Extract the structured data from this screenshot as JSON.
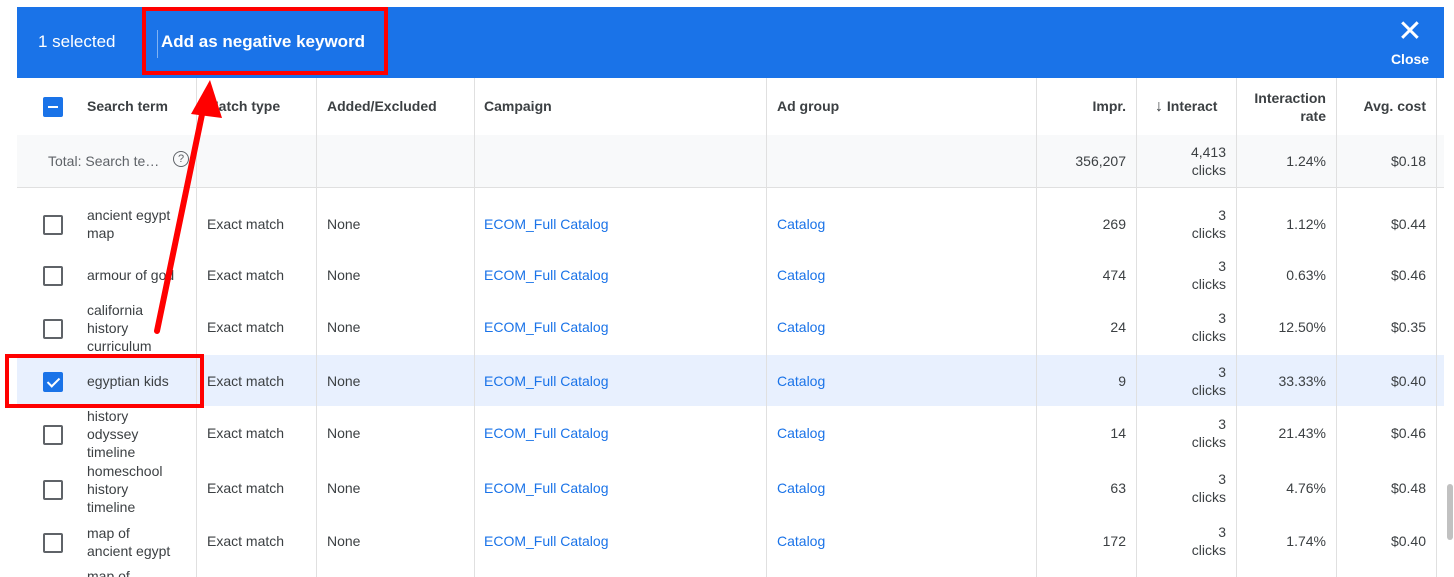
{
  "toolbar": {
    "selected_count": "1 selected",
    "add_negative_label": "Add as negative keyword",
    "close_label": "Close",
    "close_glyph": "✕"
  },
  "header": {
    "search_term": "Search term",
    "match_type": "Match type",
    "added_excluded": "Added/Excluded",
    "campaign": "Campaign",
    "ad_group": "Ad group",
    "impr": "Impr.",
    "interactions": "Interact",
    "interaction_rate_l1": "Interaction",
    "interaction_rate_l2": "rate",
    "avg_cost": "Avg. cost",
    "sort_glyph": "↓"
  },
  "total": {
    "label": "Total: Search te…",
    "help_glyph": "?",
    "impr": "356,207",
    "interactions_l1": "4,413",
    "interactions_l2": "clicks",
    "rate": "1.24%",
    "avg_cost": "$0.18"
  },
  "rows": [
    {
      "term_l1": "ancient egypt",
      "term_l2": "map",
      "term_l3": "",
      "match": "Exact match",
      "added": "None",
      "campaign": "ECOM_Full Catalog",
      "ad_group": "Catalog",
      "impr": "269",
      "int_l1": "3",
      "int_l2": "clicks",
      "rate": "1.12%",
      "cost": "$0.44"
    },
    {
      "term_l1": "armour of god",
      "term_l2": "",
      "term_l3": "",
      "match": "Exact match",
      "added": "None",
      "campaign": "ECOM_Full Catalog",
      "ad_group": "Catalog",
      "impr": "474",
      "int_l1": "3",
      "int_l2": "clicks",
      "rate": "0.63%",
      "cost": "$0.46"
    },
    {
      "term_l1": "california",
      "term_l2": "history",
      "term_l3": "curriculum",
      "match": "Exact match",
      "added": "None",
      "campaign": "ECOM_Full Catalog",
      "ad_group": "Catalog",
      "impr": "24",
      "int_l1": "3",
      "int_l2": "clicks",
      "rate": "12.50%",
      "cost": "$0.35"
    },
    {
      "term_l1": "egyptian kids",
      "term_l2": "",
      "term_l3": "",
      "match": "Exact match",
      "added": "None",
      "campaign": "ECOM_Full Catalog",
      "ad_group": "Catalog",
      "impr": "9",
      "int_l1": "3",
      "int_l2": "clicks",
      "rate": "33.33%",
      "cost": "$0.40"
    },
    {
      "term_l1": "history",
      "term_l2": "odyssey",
      "term_l3": "timeline",
      "match": "Exact match",
      "added": "None",
      "campaign": "ECOM_Full Catalog",
      "ad_group": "Catalog",
      "impr": "14",
      "int_l1": "3",
      "int_l2": "clicks",
      "rate": "21.43%",
      "cost": "$0.46"
    },
    {
      "term_l1": "homeschool",
      "term_l2": "history",
      "term_l3": "timeline",
      "match": "Exact match",
      "added": "None",
      "campaign": "ECOM_Full Catalog",
      "ad_group": "Catalog",
      "impr": "63",
      "int_l1": "3",
      "int_l2": "clicks",
      "rate": "4.76%",
      "cost": "$0.48"
    },
    {
      "term_l1": "map of",
      "term_l2": "ancient egypt",
      "term_l3": "",
      "match": "Exact match",
      "added": "None",
      "campaign": "ECOM_Full Catalog",
      "ad_group": "Catalog",
      "impr": "172",
      "int_l1": "3",
      "int_l2": "clicks",
      "rate": "1.74%",
      "cost": "$0.40"
    }
  ],
  "partial_next_row": "map of",
  "colors": {
    "accent": "#1a73e8",
    "annotation": "#ff0000",
    "selected_row": "#e8f0fe"
  }
}
